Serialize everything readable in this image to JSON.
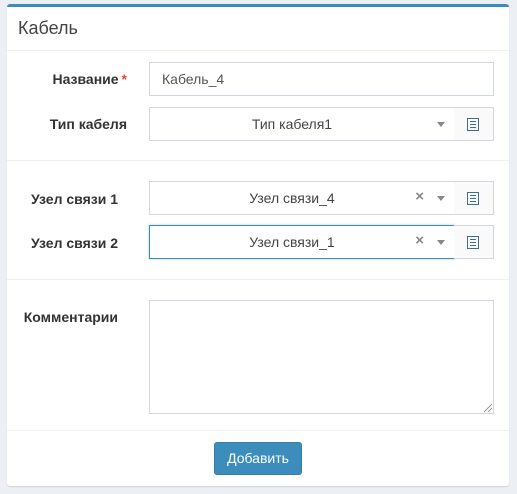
{
  "panel": {
    "title": "Кабель"
  },
  "form": {
    "name": {
      "label": "Название",
      "required_mark": "*",
      "value": "Кабель_4"
    },
    "cable_type": {
      "label": "Тип кабеля",
      "value": "Тип кабеля1"
    },
    "node1": {
      "label": "Узел связи 1",
      "value": "Узел связи_4",
      "clear": "×"
    },
    "node2": {
      "label": "Узел связи 2",
      "value": "Узел связи_1",
      "clear": "×"
    },
    "comments": {
      "label": "Комментарии",
      "value": ""
    }
  },
  "actions": {
    "submit_label": "Добавить"
  },
  "colors": {
    "accent": "#3c8dbc",
    "required": "#dd4b39",
    "background": "#ecf0f5"
  },
  "icons": {
    "select_toggle": "chevron-down-icon",
    "dictionary_button": "list-icon",
    "clear": "close-icon"
  }
}
